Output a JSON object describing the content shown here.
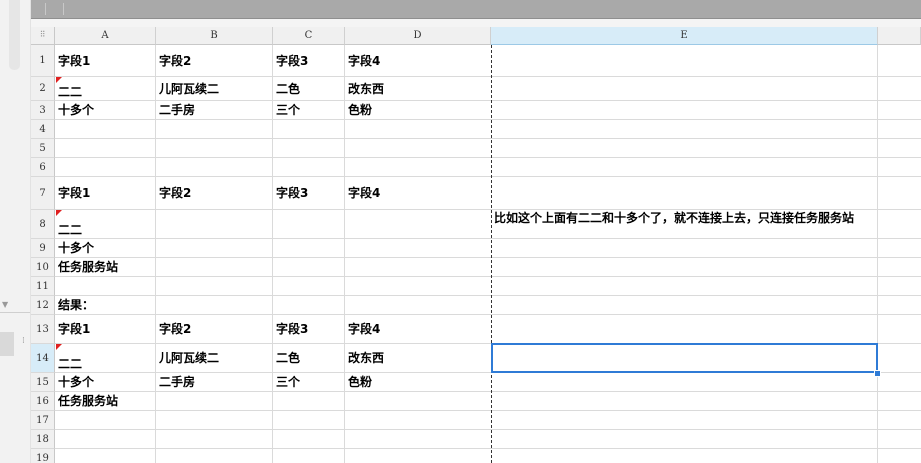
{
  "columns": [
    "A",
    "B",
    "C",
    "D",
    "E"
  ],
  "row_numbers": [
    "1",
    "2",
    "3",
    "4",
    "5",
    "6",
    "7",
    "8",
    "9",
    "10",
    "11",
    "12",
    "13",
    "14",
    "15",
    "16",
    "17",
    "18",
    "19"
  ],
  "cells": {
    "r1": {
      "A": "字段1",
      "B": "字段2",
      "C": "字段3",
      "D": "字段4"
    },
    "r2": {
      "A": "二二",
      "B": "儿阿瓦续二",
      "C": "二色",
      "D": "改东西"
    },
    "r3": {
      "A": "十多个",
      "B": "二手房",
      "C": "三个",
      "D": "色粉"
    },
    "r7": {
      "A": "字段1",
      "B": "字段2",
      "C": "字段3",
      "D": "字段4"
    },
    "r8": {
      "A": "二二",
      "E": "比如这个上面有二二和十多个了，就不连接上去，只连接任务服务站"
    },
    "r9": {
      "A": "十多个"
    },
    "r10": {
      "A": "任务服务站"
    },
    "r12": {
      "A": "结果："
    },
    "r13": {
      "A": "字段1",
      "B": "字段2",
      "C": "字段3",
      "D": "字段4"
    },
    "r14": {
      "A": "二二",
      "B": "儿阿瓦续二",
      "C": "二色",
      "D": "改东西"
    },
    "r15": {
      "A": "十多个",
      "B": "二手房",
      "C": "三个",
      "D": "色粉"
    },
    "r16": {
      "A": "任务服务站"
    }
  },
  "selection": {
    "cell": "E14",
    "selected_column": "E",
    "selected_row": "14"
  },
  "colors": {
    "selection": "#2f7bd6",
    "comment_marker": "#e02020",
    "header_selected": "#d7ecf8"
  },
  "icons": {
    "corner": "select-all-icon",
    "splitter": "splitter-handle-icon"
  }
}
